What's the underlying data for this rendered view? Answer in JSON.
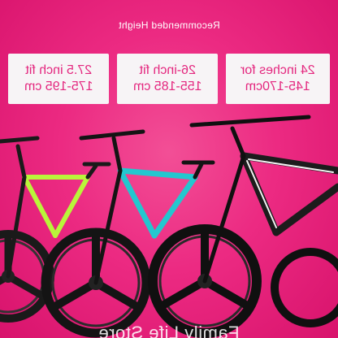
{
  "heading": "Recommended Height",
  "size_cards": [
    {
      "id": "275",
      "text": "27.5 inch fit\n175-195 cm"
    },
    {
      "id": "26",
      "text": "26-inch fit\n155-185 cm"
    },
    {
      "id": "24",
      "text": "24 inches for\n145-170cm"
    }
  ],
  "watermark": "Family Life Store",
  "bikes": [
    {
      "frame_color": "#c6ff3a",
      "label": "left-bike"
    },
    {
      "frame_color": "#23c7cf",
      "label": "middle-bike"
    },
    {
      "frame_color": "#f2f2f2",
      "label": "right-bike"
    }
  ],
  "colors": {
    "background": "#ec2a82",
    "card_background": "#f7f4f6",
    "card_text": "#e4267e",
    "heading_text": "#ffffff"
  }
}
